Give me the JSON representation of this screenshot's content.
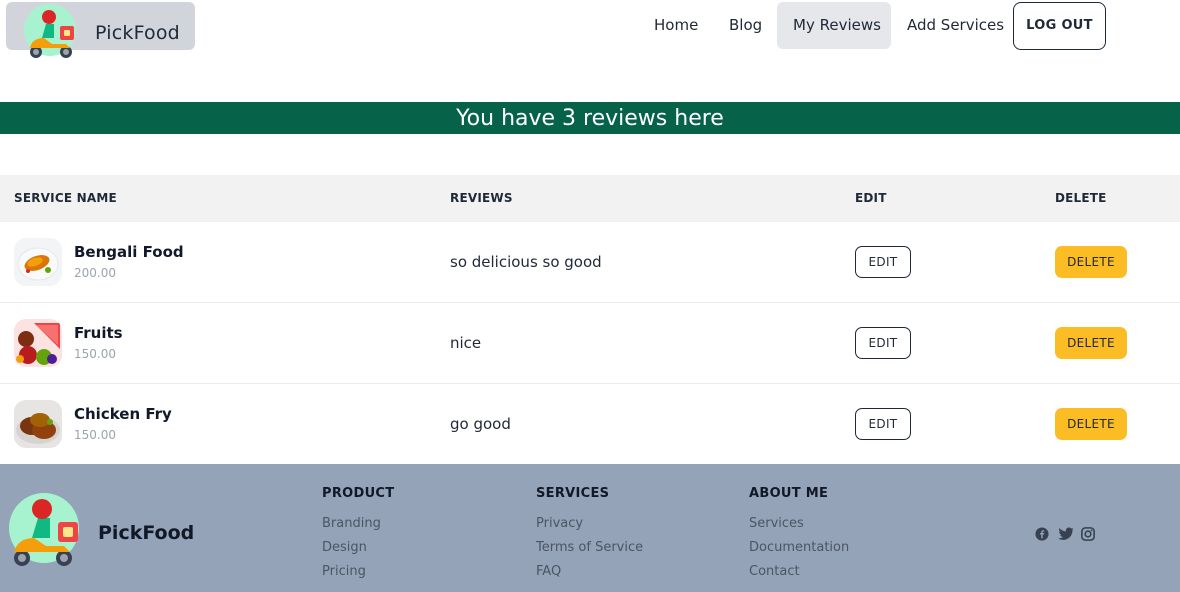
{
  "brand": {
    "name": "PickFood"
  },
  "nav": {
    "items": [
      {
        "label": "Home"
      },
      {
        "label": "Blog"
      },
      {
        "label": "My Reviews"
      },
      {
        "label": "Add Services"
      }
    ],
    "logout_label": "LOG OUT"
  },
  "banner": {
    "text": "You have 3 reviews here"
  },
  "table": {
    "headers": [
      "SERVICE NAME",
      "REVIEWS",
      "EDIT",
      "DELETE"
    ],
    "rows": [
      {
        "name": "Bengali Food",
        "price": "200.00",
        "review": "so delicious so good",
        "edit": "EDIT",
        "delete": "DELETE",
        "thumb": "fish-curry-image"
      },
      {
        "name": "Fruits",
        "price": "150.00",
        "review": "nice",
        "edit": "EDIT",
        "delete": "DELETE",
        "thumb": "fruits-image"
      },
      {
        "name": "Chicken Fry",
        "price": "150.00",
        "review": "go good",
        "edit": "EDIT",
        "delete": "DELETE",
        "thumb": "chicken-fry-image"
      }
    ]
  },
  "footer": {
    "brand": "PickFood",
    "columns": [
      {
        "title": "PRODUCT",
        "links": [
          "Branding",
          "Design",
          "Pricing"
        ]
      },
      {
        "title": "SERVICES",
        "links": [
          "Privacy",
          "Terms of Service",
          "FAQ"
        ]
      },
      {
        "title": "ABOUT ME",
        "links": [
          "Services",
          "Documentation",
          "Contact"
        ]
      }
    ],
    "social": [
      "facebook-icon",
      "twitter-icon",
      "instagram-icon"
    ]
  },
  "colors": {
    "banner": "#06634a",
    "footer": "#94a3b8",
    "delete_button": "#fbbd23",
    "header_row": "#f2f2f2"
  }
}
